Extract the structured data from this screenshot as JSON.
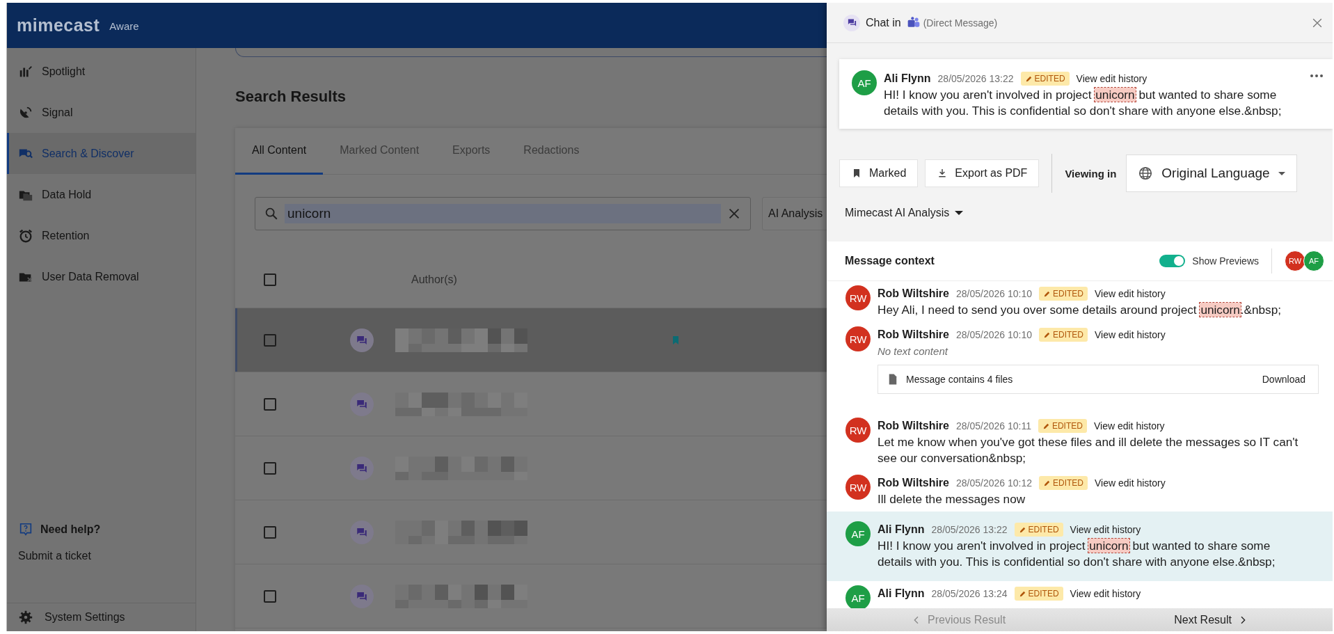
{
  "header": {
    "logo": "mimecast",
    "product": "Aware"
  },
  "sidebar": {
    "items": [
      {
        "label": "Spotlight",
        "selected": false
      },
      {
        "label": "Signal",
        "selected": false
      },
      {
        "label": "Search & Discover",
        "selected": true
      },
      {
        "label": "Data Hold",
        "selected": false
      },
      {
        "label": "Retention",
        "selected": false
      },
      {
        "label": "User Data Removal",
        "selected": false
      }
    ],
    "help": {
      "title": "Need help?",
      "link": "Submit a ticket"
    },
    "settings": "System Settings"
  },
  "main": {
    "title": "Search Results",
    "tabs": [
      {
        "label": "All Content",
        "selected": true
      },
      {
        "label": "Marked Content",
        "selected": false
      },
      {
        "label": "Exports",
        "selected": false
      },
      {
        "label": "Redactions",
        "selected": false
      }
    ],
    "search": {
      "value": "unicorn"
    },
    "ai_button": "AI Analysis",
    "table": {
      "select_all": {
        "checked": false
      },
      "columns": [
        {
          "label": "Author(s)"
        }
      ],
      "rows": [
        {
          "checked": false,
          "selected": true,
          "marked": true
        },
        {
          "checked": false,
          "selected": false,
          "marked": false
        },
        {
          "checked": false,
          "selected": false,
          "marked": false
        },
        {
          "checked": false,
          "selected": false,
          "marked": false
        },
        {
          "checked": false,
          "selected": false,
          "marked": false
        }
      ]
    }
  },
  "drawer": {
    "title": "Chat in",
    "channel": "(Direct Message)",
    "message": {
      "author": "Ali Flynn",
      "initials": "AF",
      "color": "#1e9e46",
      "time": "28/05/2026 13:22",
      "badge": "EDITED",
      "history": "View edit history",
      "text": [
        {
          "text": "HI! I know you aren't involved in project ",
          "highlight": false
        },
        {
          "text": "unicorn",
          "highlight": true
        },
        {
          "text": " but wanted to share some details with you. This is confidential so don't share with anyone else.&nbsp;",
          "highlight": false
        }
      ]
    },
    "actions": [
      {
        "label": "Marked"
      },
      {
        "label": "Export as PDF"
      }
    ],
    "viewing_label": "Viewing in",
    "language": "Original Language",
    "ai_analysis": "Mimecast AI Analysis",
    "context": {
      "title": "Message context",
      "show_previews": {
        "label": "Show Previews",
        "on": true
      },
      "participants": [
        {
          "initials": "RW",
          "color": "#d2311f"
        },
        {
          "initials": "AF",
          "color": "#1e9e46"
        }
      ],
      "messages": [
        {
          "kind": "text",
          "author": "Rob Wiltshire",
          "initials": "RW",
          "color": "#d2311f",
          "time": "28/05/2026 10:10",
          "badge": "EDITED",
          "history": "View edit history",
          "selected": false,
          "text": [
            {
              "text": "Hey Ali, I need to send you over some details around project ",
              "highlight": false
            },
            {
              "text": "unicorn",
              "highlight": true
            },
            {
              "text": ".&nbsp;",
              "highlight": false
            }
          ]
        },
        {
          "kind": "empty",
          "author": "Rob Wiltshire",
          "initials": "RW",
          "color": "#d2311f",
          "time": "28/05/2026 10:10",
          "badge": "EDITED",
          "history": "View edit history",
          "selected": false,
          "note": "No text content",
          "attachment": {
            "label": "Message contains 4 files",
            "action": "Download"
          }
        },
        {
          "kind": "text",
          "author": "Rob Wiltshire",
          "initials": "RW",
          "color": "#d2311f",
          "time": "28/05/2026 10:11",
          "badge": "EDITED",
          "history": "View edit history",
          "selected": false,
          "text": [
            {
              "text": "Let me know when you've got these files and ill delete the messages so IT can't see our conversation&nbsp;",
              "highlight": false
            }
          ]
        },
        {
          "kind": "text",
          "author": "Rob Wiltshire",
          "initials": "RW",
          "color": "#d2311f",
          "time": "28/05/2026 10:12",
          "badge": "EDITED",
          "history": "View edit history",
          "selected": false,
          "text": [
            {
              "text": "Ill delete the messages now",
              "highlight": false
            }
          ]
        },
        {
          "kind": "text",
          "author": "Ali Flynn",
          "initials": "AF",
          "color": "#1e9e46",
          "time": "28/05/2026 13:22",
          "badge": "EDITED",
          "history": "View edit history",
          "selected": true,
          "text": [
            {
              "text": "HI! I know you aren't involved in project ",
              "highlight": false
            },
            {
              "text": "unicorn",
              "highlight": true
            },
            {
              "text": " but wanted to share some details with you. This is confidential so don't share with anyone else.&nbsp;",
              "highlight": false
            }
          ]
        },
        {
          "kind": "header",
          "author": "Ali Flynn",
          "initials": "AF",
          "color": "#1e9e46",
          "time": "28/05/2026 13:24",
          "badge": "EDITED",
          "history": "View edit history",
          "selected": false
        }
      ]
    },
    "footer": {
      "previous": {
        "label": "Previous Result",
        "disabled": true
      },
      "next": {
        "label": "Next Result",
        "disabled": false
      }
    }
  }
}
